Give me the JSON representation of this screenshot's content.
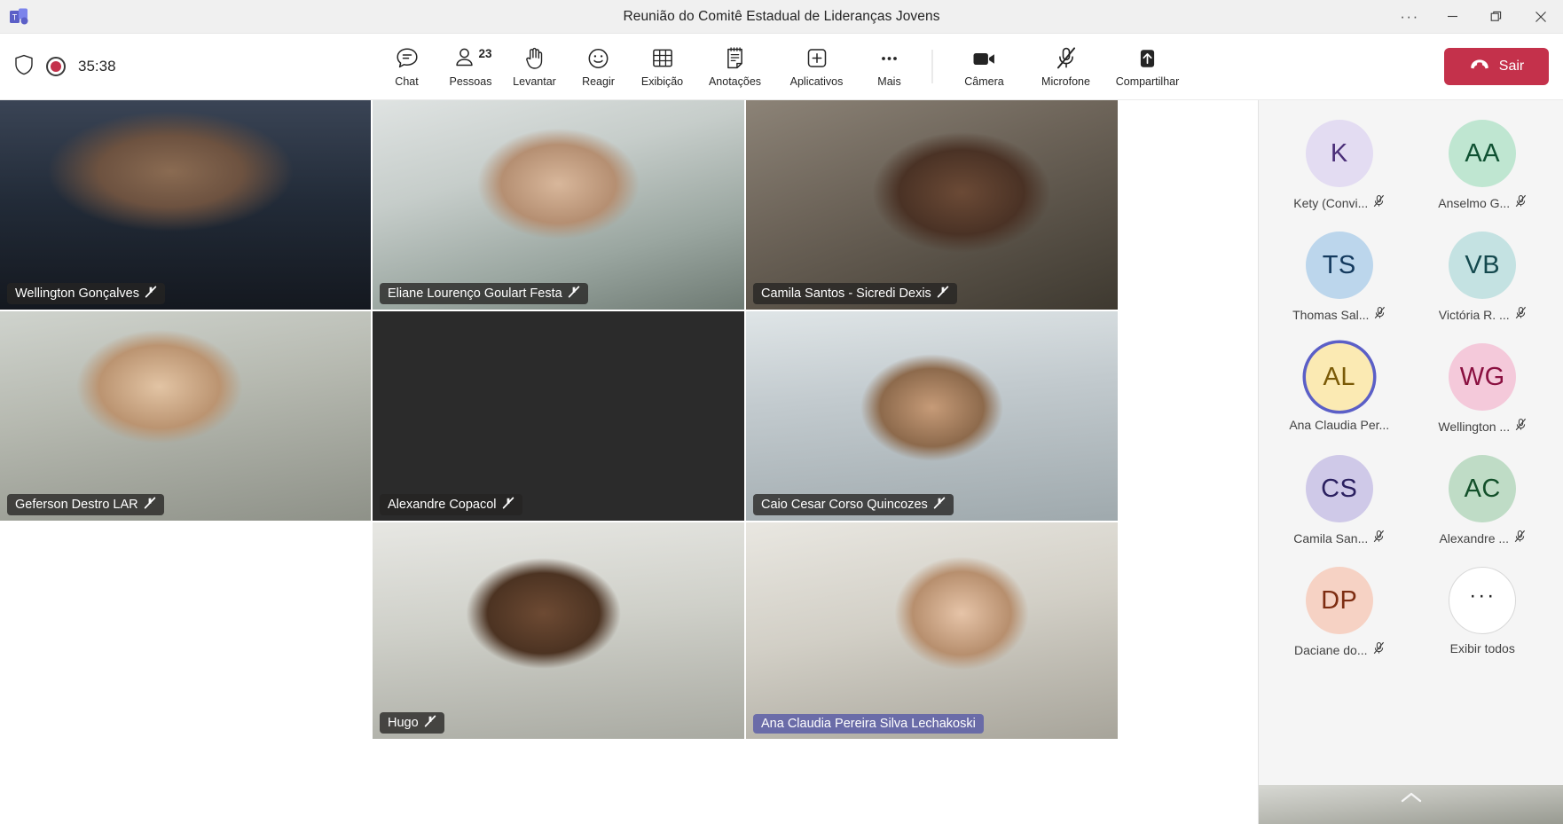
{
  "window": {
    "app_icon": "teams-logo-icon",
    "title": "Reunião do Comitê Estadual de Lideranças Jovens",
    "more_label": "···",
    "minimize_label": "Minimizar",
    "restore_label": "Restaurar",
    "close_label": "Fechar"
  },
  "toolbar": {
    "shield_icon": "shield-icon",
    "recording_icon": "record-icon",
    "timer": "35:38",
    "items": [
      {
        "label": "Chat",
        "icon": "chat-icon"
      },
      {
        "label": "Pessoas",
        "icon": "people-icon",
        "count": "23"
      },
      {
        "label": "Levantar",
        "icon": "raise-hand-icon"
      },
      {
        "label": "Reagir",
        "icon": "reaction-smiley-icon"
      },
      {
        "label": "Exibição",
        "icon": "view-grid-icon"
      },
      {
        "label": "Anotações",
        "icon": "notes-icon"
      },
      {
        "label": "Aplicativos",
        "icon": "apps-plus-icon"
      },
      {
        "label": "Mais",
        "icon": "more-ellipsis-icon"
      }
    ],
    "device_items": [
      {
        "label": "Câmera",
        "icon": "camera-icon",
        "state": "off"
      },
      {
        "label": "Microfone",
        "icon": "microphone-muted-icon",
        "state": "muted"
      },
      {
        "label": "Compartilhar",
        "icon": "share-screen-icon",
        "state": "off"
      }
    ],
    "leave": {
      "label": "Sair",
      "icon": "hangup-icon",
      "color": "#c4314b"
    }
  },
  "stage": {
    "tiles": [
      {
        "name": "Wellington Gonçalves",
        "muted": true,
        "speaking": false,
        "video_class": "v1"
      },
      {
        "name": "Eliane Lourenço Goulart Festa",
        "muted": true,
        "speaking": false,
        "video_class": "v2"
      },
      {
        "name": "Camila Santos - Sicredi Dexis",
        "muted": true,
        "speaking": false,
        "video_class": "v3"
      },
      {
        "name": "Alexandre Copacol",
        "muted": true,
        "speaking": false,
        "video_class": "v4"
      },
      {
        "name": "Caio Cesar Corso Quincozes",
        "muted": true,
        "speaking": false,
        "video_class": "v5"
      },
      {
        "name": "Geferson Destro LAR",
        "muted": true,
        "speaking": false,
        "video_class": "v6"
      },
      {
        "name": "Hugo",
        "muted": true,
        "speaking": false,
        "video_class": "v7"
      },
      {
        "name": "Ana Claudia Pereira Silva Lechakoski",
        "muted": false,
        "speaking": true,
        "video_class": "v8"
      }
    ]
  },
  "panel": {
    "people": [
      {
        "initials": "K",
        "name": "Kety (Convi...",
        "bg": "#e3dcf2",
        "fg": "#4a2e78",
        "muted": true,
        "speaking": false
      },
      {
        "initials": "AA",
        "name": "Anselmo G...",
        "bg": "#bfe6d1",
        "fg": "#0f5132",
        "muted": true,
        "speaking": false
      },
      {
        "initials": "TS",
        "name": "Thomas Sal...",
        "bg": "#bcd6ec",
        "fg": "#143a5e",
        "muted": true,
        "speaking": false
      },
      {
        "initials": "VB",
        "name": "Victória R. ...",
        "bg": "#c4e2e2",
        "fg": "#14494e",
        "muted": true,
        "speaking": false
      },
      {
        "initials": "AL",
        "name": "Ana Claudia Per...",
        "bg": "#fbeab3",
        "fg": "#7a5a07",
        "muted": false,
        "speaking": true
      },
      {
        "initials": "WG",
        "name": "Wellington ...",
        "bg": "#f4c9da",
        "fg": "#8a1040",
        "muted": true,
        "speaking": false
      },
      {
        "initials": "CS",
        "name": "Camila San...",
        "bg": "#cfc9e8",
        "fg": "#2b2060",
        "muted": true,
        "speaking": false
      },
      {
        "initials": "AC",
        "name": "Alexandre ...",
        "bg": "#bfdcc6",
        "fg": "#13502a",
        "muted": true,
        "speaking": false
      },
      {
        "initials": "DP",
        "name": "Daciane do...",
        "bg": "#f6d2c4",
        "fg": "#7d2c11",
        "muted": true,
        "speaking": false
      }
    ],
    "show_all": {
      "label": "Exibir todos",
      "icon": "more-ellipsis-icon"
    },
    "collapse_icon": "chevron-up-icon"
  }
}
